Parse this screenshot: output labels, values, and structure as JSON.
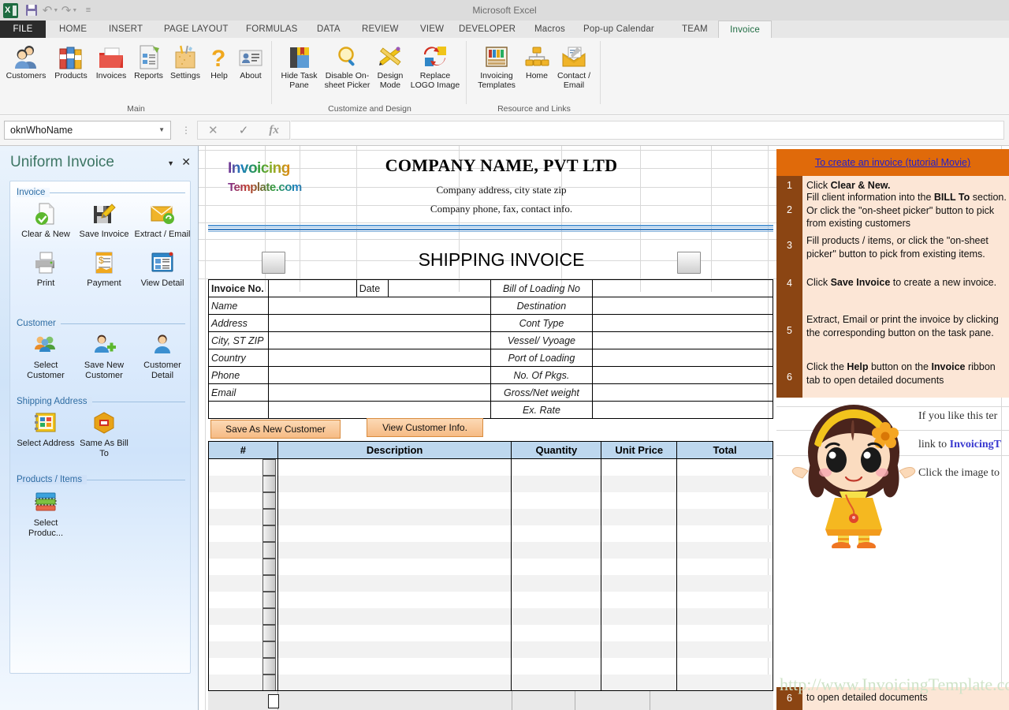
{
  "window": {
    "app_title": "Microsoft Excel"
  },
  "quick_access": {
    "items": [
      {
        "name": "excel-logo",
        "label": "Excel"
      },
      {
        "name": "save",
        "label": "Save"
      },
      {
        "name": "undo",
        "label": "Undo"
      },
      {
        "name": "redo",
        "label": "Redo"
      },
      {
        "name": "customize-qat",
        "label": "Customize Quick Access Toolbar"
      }
    ]
  },
  "ribbon": {
    "tabs": [
      {
        "label": "FILE",
        "active": false,
        "file": true
      },
      {
        "label": "HOME",
        "active": false
      },
      {
        "label": "INSERT",
        "active": false
      },
      {
        "label": "PAGE LAYOUT",
        "active": false
      },
      {
        "label": "FORMULAS",
        "active": false
      },
      {
        "label": "DATA",
        "active": false
      },
      {
        "label": "REVIEW",
        "active": false
      },
      {
        "label": "VIEW",
        "active": false
      },
      {
        "label": "DEVELOPER",
        "active": false
      },
      {
        "label": "Macros",
        "active": false
      },
      {
        "label": "Pop-up Calendar",
        "active": false
      },
      {
        "label": "TEAM",
        "active": false
      },
      {
        "label": "Invoice",
        "active": true
      }
    ],
    "active_tab_color": "#1e6b41",
    "groups": [
      {
        "label": "Main",
        "buttons": [
          {
            "label": "Customers",
            "icon": "customers-icon"
          },
          {
            "label": "Products",
            "icon": "products-icon"
          },
          {
            "label": "Invoices",
            "icon": "invoices-icon"
          },
          {
            "label": "Reports",
            "icon": "reports-icon"
          },
          {
            "label": "Settings",
            "icon": "settings-icon"
          },
          {
            "label": "Help",
            "icon": "help-icon"
          },
          {
            "label": "About",
            "icon": "about-icon"
          }
        ]
      },
      {
        "label": "Customize and Design",
        "buttons": [
          {
            "label": "Hide Task Pane",
            "icon": "hide-task-pane-icon"
          },
          {
            "label": "Disable On-sheet Picker",
            "icon": "disable-picker-icon"
          },
          {
            "label": "Design Mode",
            "icon": "design-mode-icon"
          },
          {
            "label": "Replace LOGO Image",
            "icon": "replace-logo-icon"
          }
        ]
      },
      {
        "label": "Resource and Links",
        "buttons": [
          {
            "label": "Invoicing Templates",
            "icon": "invoicing-templates-icon"
          },
          {
            "label": "Home",
            "icon": "home-icon"
          },
          {
            "label": "Contact / Email",
            "icon": "contact-email-icon"
          }
        ]
      }
    ]
  },
  "formula_bar": {
    "name_box_value": "oknWhoName",
    "formula_value": "",
    "cancel_icon": "cancel-icon",
    "enter_icon": "confirm-icon",
    "function_icon": "insert-function-icon"
  },
  "task_pane": {
    "title": "Uniform Invoice",
    "minimize_icon": "chevron-down-icon",
    "close_icon": "close-icon",
    "sections": [
      {
        "title": "Invoice",
        "items": [
          {
            "label": "Clear & New",
            "icon": "clear-new-icon"
          },
          {
            "label": "Save Invoice",
            "icon": "save-invoice-icon"
          },
          {
            "label": "Extract / Email",
            "icon": "extract-email-icon"
          },
          {
            "label": "Print",
            "icon": "print-icon"
          },
          {
            "label": "Payment",
            "icon": "payment-icon"
          },
          {
            "label": "View Detail",
            "icon": "view-detail-icon"
          }
        ]
      },
      {
        "title": "Customer",
        "items": [
          {
            "label": "Select Customer",
            "icon": "select-customer-icon"
          },
          {
            "label": "Save New Customer",
            "icon": "save-new-customer-icon"
          },
          {
            "label": "Customer Detail",
            "icon": "customer-detail-icon"
          }
        ]
      },
      {
        "title": "Shipping Address",
        "items": [
          {
            "label": "Select Address",
            "icon": "select-address-icon"
          },
          {
            "label": "Same As Bill To",
            "icon": "same-as-bill-to-icon"
          }
        ]
      },
      {
        "title": "Products / Items",
        "items": [
          {
            "label": "Select Produc...",
            "icon": "select-products-icon"
          }
        ]
      }
    ]
  },
  "invoice": {
    "logo": {
      "line1": "Invoicing",
      "line2": "Template.com"
    },
    "company_name": "COMPANY NAME,  PVT LTD",
    "company_address": "Company address, city state zip",
    "company_contact": "Company phone, fax, contact info.",
    "doc_title": "SHIPPING INVOICE",
    "left_fields": [
      {
        "label": "Invoice No.",
        "value": "",
        "bold": true
      },
      {
        "label": "Name",
        "value": ""
      },
      {
        "label": "Address",
        "value": ""
      },
      {
        "label": "City, ST ZIP",
        "value": ""
      },
      {
        "label": "Country",
        "value": ""
      },
      {
        "label": "Phone",
        "value": ""
      },
      {
        "label": "Email",
        "value": ""
      },
      {
        "label": "",
        "value": ""
      }
    ],
    "date_label": "Date",
    "date_value": "",
    "right_fields": [
      {
        "label": "Bill of Loading No",
        "value": ""
      },
      {
        "label": "Destination",
        "value": ""
      },
      {
        "label": "Cont Type",
        "value": ""
      },
      {
        "label": "Vessel/ Vyoage",
        "value": ""
      },
      {
        "label": "Port of Loading",
        "value": ""
      },
      {
        "label": "No. Of Pkgs.",
        "value": ""
      },
      {
        "label": "Gross/Net weight",
        "value": ""
      },
      {
        "label": "Ex. Rate",
        "value": ""
      }
    ],
    "buttons": [
      {
        "label": "Save As New Customer",
        "name": "save-as-new-customer-button"
      },
      {
        "label": "View Customer Info.",
        "name": "view-customer-info-button"
      }
    ],
    "items_headers": [
      "#",
      "Description",
      "Quantity",
      "Unit Price",
      "Total"
    ],
    "items_rows": 14
  },
  "help_panel": {
    "tutorial_link": "To create an invoice (tutorial Movie)",
    "header_color": "#e06a0a",
    "number_column_color": "#8b4513",
    "body_color": "#fce6d6",
    "steps": [
      {
        "number": "1",
        "text": "Click ",
        "bold": "Clear & New.",
        "tail": ""
      },
      {
        "number": "2",
        "text": "Fill client information into the ",
        "bold": "BILL To",
        "tail": " section. Or click the \"on-sheet picker\" button to pick from existing customers"
      },
      {
        "number": "3",
        "text": "Fill products / items, or click the \"on-sheet picker\" button to pick from existing items.",
        "bold": "",
        "tail": ""
      },
      {
        "number": "4",
        "text": "Click ",
        "bold": "Save Invoice",
        "tail": " to create a new invoice."
      },
      {
        "number": "5",
        "text": "Extract, Email or print the invoice by clicking the corresponding button on the task pane.",
        "bold": "",
        "tail": ""
      },
      {
        "number": "6",
        "text": "Click the ",
        "bold": "Help",
        "tail": " button on the "
      }
    ],
    "step6_bold2": "Invoice",
    "step6_tail2": " ribbon",
    "step6_line2": "tab to open detailed documents",
    "footer_number": "6",
    "footer_text": "to open detailed documents"
  },
  "promo": {
    "line1": "If you like this ter",
    "line2_pre": "link to ",
    "line2_link": "InvoicingT",
    "line3": "Click the image to",
    "mascot_icon": "mascot-girl-image"
  },
  "watermark": {
    "text": "http://www.InvoicingTemplate.com"
  }
}
